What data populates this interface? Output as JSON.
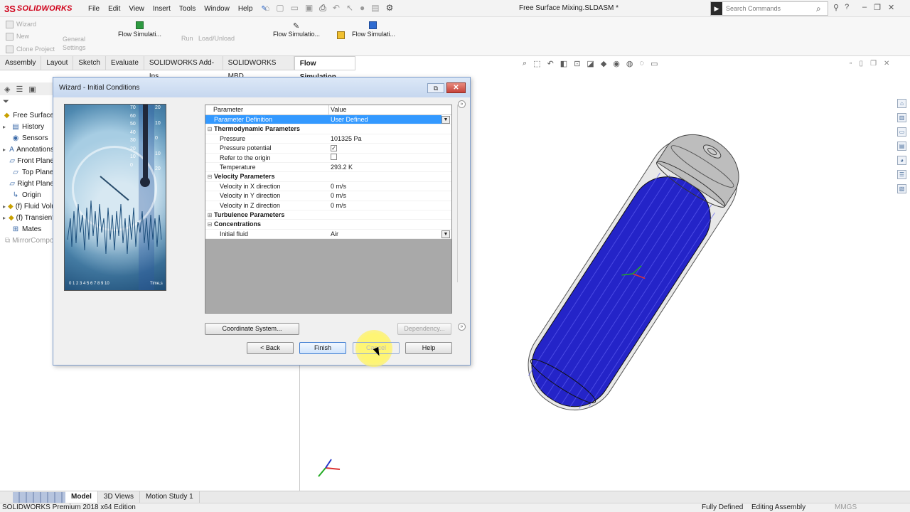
{
  "app": {
    "name": "SOLIDWORKS",
    "document_title": "Free Surface Mixing.SLDASM *"
  },
  "menu": [
    "File",
    "Edit",
    "View",
    "Insert",
    "Tools",
    "Window",
    "Help"
  ],
  "search": {
    "placeholder": "Search Commands"
  },
  "ribbon": {
    "wizard": "Wizard",
    "new": "New",
    "clone_project": "Clone Project",
    "general": "General",
    "settings": "Settings",
    "flow_sim_1": "Flow Simulati...",
    "run": "Run",
    "load_unload": "Load/Unload",
    "flow_sim_2": "Flow Simulatio...",
    "flow_sim_3": "Flow Simulati..."
  },
  "tabs": [
    "Assembly",
    "Layout",
    "Sketch",
    "Evaluate",
    "SOLIDWORKS Add-Ins",
    "SOLIDWORKS MBD",
    "Flow Simulation"
  ],
  "active_tab": "Flow Simulation",
  "tree": {
    "root": "Free Surface",
    "items": [
      {
        "label": "History",
        "icon": "history-icon",
        "glyph": "▤",
        "expandable": true
      },
      {
        "label": "Sensors",
        "icon": "sensor-icon",
        "glyph": "◉",
        "expandable": false
      },
      {
        "label": "Annotations",
        "icon": "annotation-icon",
        "glyph": "A",
        "expandable": true
      },
      {
        "label": "Front Plane",
        "icon": "plane-icon",
        "glyph": "▱",
        "expandable": false
      },
      {
        "label": "Top Plane",
        "icon": "plane-icon",
        "glyph": "▱",
        "expandable": false
      },
      {
        "label": "Right Plane",
        "icon": "plane-icon",
        "glyph": "▱",
        "expandable": false
      },
      {
        "label": "Origin",
        "icon": "origin-icon",
        "glyph": "↳",
        "expandable": false
      },
      {
        "label": "(f) Fluid Volume",
        "icon": "part-icon",
        "glyph": "◆",
        "expandable": true
      },
      {
        "label": "(f) Transient",
        "icon": "part-icon",
        "glyph": "◆",
        "expandable": true
      },
      {
        "label": "Mates",
        "icon": "mates-icon",
        "glyph": "⊞",
        "expandable": false
      },
      {
        "label": "MirrorComponent",
        "icon": "mirror-icon",
        "glyph": "⧉",
        "expandable": false,
        "dim": true
      }
    ]
  },
  "dialog": {
    "title": "Wizard - Initial Conditions",
    "image_scale": {
      "left_ticks": [
        "70",
        "60",
        "50",
        "40",
        "30",
        "20",
        "10",
        "0"
      ],
      "right_ticks": [
        "20",
        "10",
        "0",
        "10",
        "20"
      ],
      "time_ticks": "0  1  2  3  4  5  6  7  8  9  10",
      "time_label": "Time,s"
    },
    "columns": {
      "parameter": "Parameter",
      "value": "Value"
    },
    "rows": [
      {
        "param": "Parameter Definition",
        "value": "User Defined",
        "selected": true,
        "dropdown": true
      },
      {
        "param": "Thermodynamic Parameters",
        "group": true,
        "expanded": true
      },
      {
        "param": "Pressure",
        "value": "101325 Pa"
      },
      {
        "param": "Pressure potential",
        "check": true,
        "checked": true
      },
      {
        "param": "Refer to the origin",
        "check": true,
        "checked": false
      },
      {
        "param": "Temperature",
        "value": "293.2 K"
      },
      {
        "param": "Velocity Parameters",
        "group": true,
        "expanded": true
      },
      {
        "param": "Velocity in X direction",
        "value": "0 m/s"
      },
      {
        "param": "Velocity in Y direction",
        "value": "0 m/s"
      },
      {
        "param": "Velocity in Z direction",
        "value": "0 m/s"
      },
      {
        "param": "Turbulence Parameters",
        "group": true,
        "expanded": false
      },
      {
        "param": "Concentrations",
        "group": true,
        "expanded": true
      },
      {
        "param": "Initial fluid",
        "value": "Air",
        "dropdown": true
      }
    ],
    "buttons": {
      "coordinate_system": "Coordinate System...",
      "dependency": "Dependency...",
      "back": "< Back",
      "finish": "Finish",
      "cancel": "Cancel",
      "help": "Help"
    }
  },
  "bottom_tabs": [
    "Model",
    "3D Views",
    "Motion Study 1"
  ],
  "status": {
    "edition": "SOLIDWORKS Premium 2018 x64 Edition",
    "defined": "Fully Defined",
    "mode": "Editing Assembly",
    "units": "MMGS"
  },
  "colors": {
    "tank_body": "#2424c8",
    "tank_cap": "#bdbdbd",
    "selection": "#3399ff",
    "brand": "#d0021b"
  }
}
